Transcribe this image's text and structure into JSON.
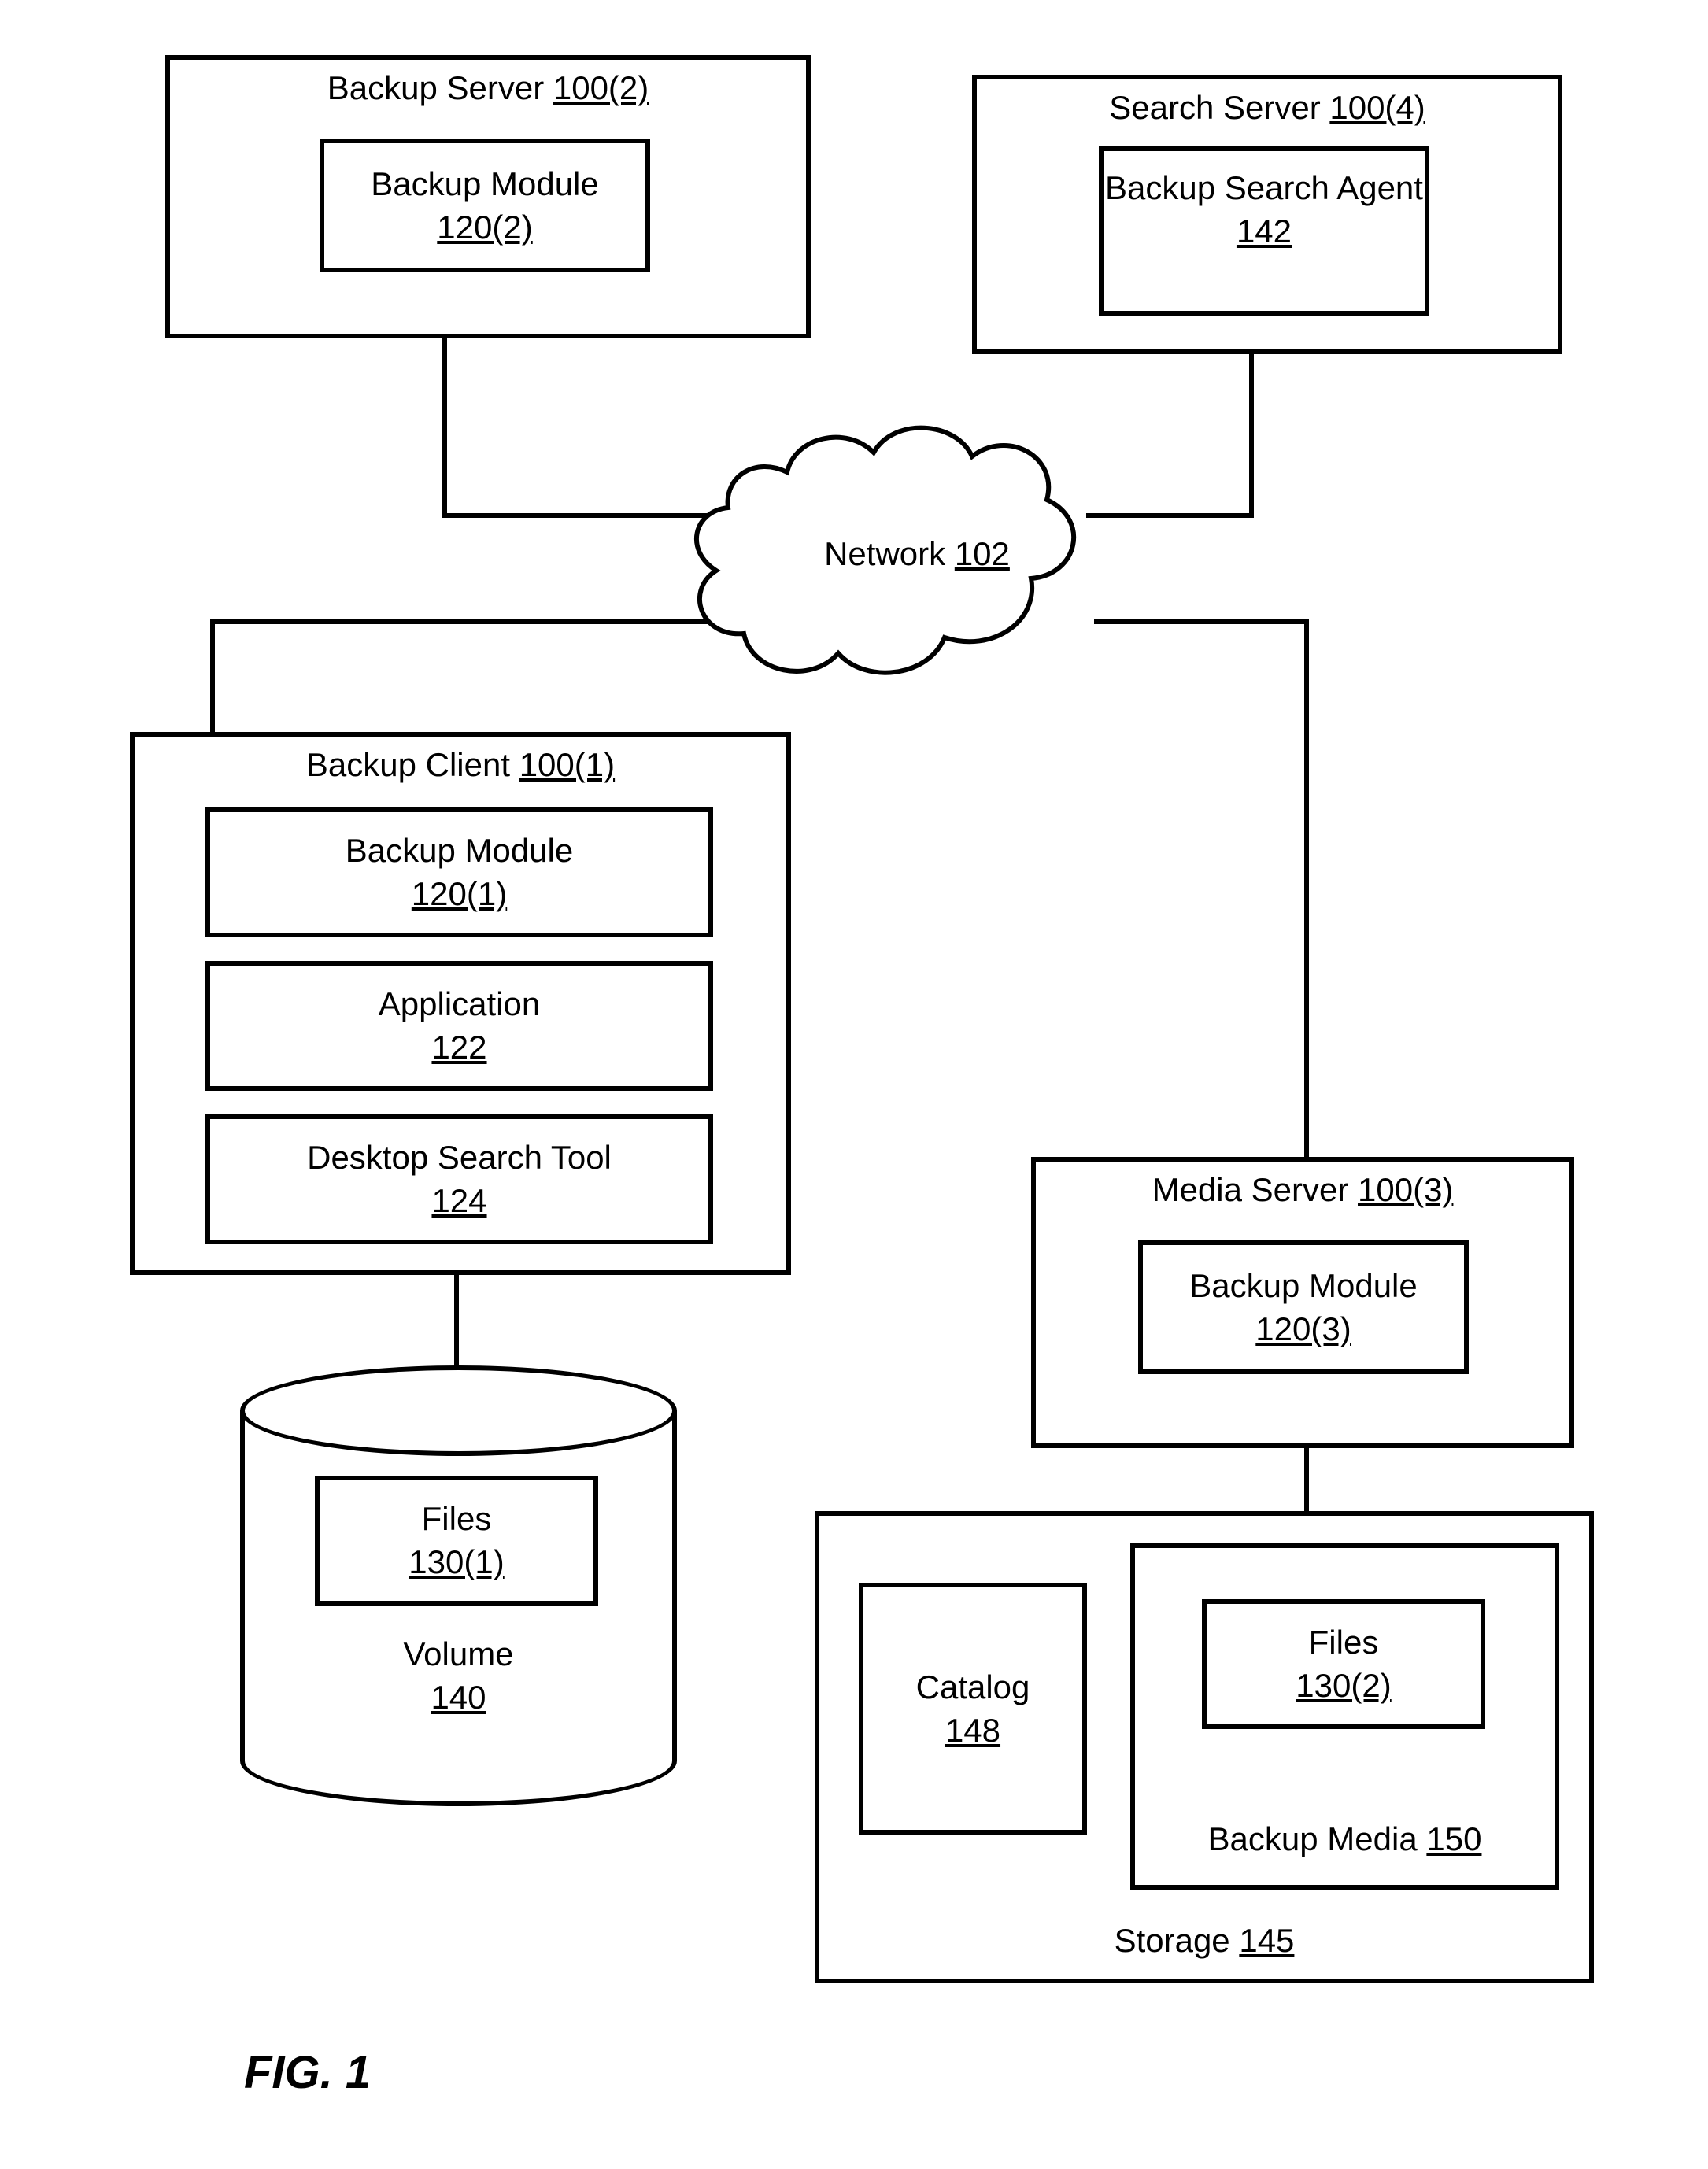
{
  "figure_label": "FIG. 1",
  "backup_server": {
    "title": "Backup Server",
    "ref": "100(2)",
    "module": {
      "label": "Backup Module",
      "ref": "120(2)"
    }
  },
  "search_server": {
    "title": "Search Server",
    "ref": "100(4)",
    "agent": {
      "label": "Backup Search Agent",
      "ref": "142"
    }
  },
  "network": {
    "label": "Network",
    "ref": "102"
  },
  "backup_client": {
    "title": "Backup Client",
    "ref": "100(1)",
    "module": {
      "label": "Backup Module",
      "ref": "120(1)"
    },
    "application": {
      "label": "Application",
      "ref": "122"
    },
    "search_tool": {
      "label": "Desktop Search Tool",
      "ref": "124"
    }
  },
  "media_server": {
    "title": "Media Server",
    "ref": "100(3)",
    "module": {
      "label": "Backup Module",
      "ref": "120(3)"
    }
  },
  "volume": {
    "label": "Volume",
    "ref": "140",
    "files": {
      "label": "Files",
      "ref": "130(1)"
    }
  },
  "storage": {
    "label": "Storage",
    "ref": "145",
    "catalog": {
      "label": "Catalog",
      "ref": "148"
    },
    "backup_media": {
      "label": "Backup Media",
      "ref": "150",
      "files": {
        "label": "Files",
        "ref": "130(2)"
      }
    }
  }
}
